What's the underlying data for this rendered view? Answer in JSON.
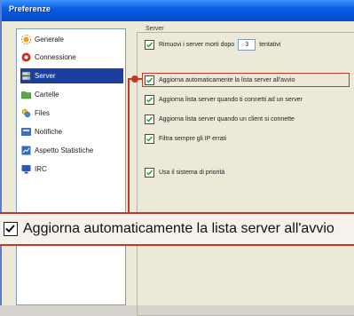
{
  "window": {
    "title": "Preferenze"
  },
  "sidebar": {
    "items": [
      {
        "label": "Generale",
        "icon": "sun-icon"
      },
      {
        "label": "Connessione",
        "icon": "connection-icon"
      },
      {
        "label": "Server",
        "icon": "server-icon",
        "selected": true
      },
      {
        "label": "Cartelle",
        "icon": "folder-icon"
      },
      {
        "label": "Files",
        "icon": "file-icon"
      },
      {
        "label": "Notifiche",
        "icon": "notification-icon"
      },
      {
        "label": "Aspetto Statistiche",
        "icon": "stats-icon"
      },
      {
        "label": "IRC",
        "icon": "irc-icon"
      }
    ]
  },
  "server_group": {
    "legend": "Server",
    "options": [
      {
        "label_before": "Rimuovi i server morti dopo",
        "value": "3",
        "label_after": "tentativi",
        "checked": true
      },
      {
        "label": "Aggiorna automaticamente la lista server all'avvio",
        "checked": true
      },
      {
        "label": "Aggiorna lista server quando ti connetti ad un server",
        "checked": true
      },
      {
        "label": "Aggiorna lista server quando un client si connette",
        "checked": true
      },
      {
        "label": "Filtra sempre gli IP errati",
        "checked": true
      },
      {
        "label": "Usa il sistema di priorità",
        "checked": true
      }
    ]
  },
  "zoom": {
    "label": "Aggiorna automaticamente la lista server all'avvio",
    "checked": true
  },
  "colors": {
    "accent": "#c0392b",
    "selection": "#1a3f9c",
    "titlebar": "#0a5fe0"
  }
}
